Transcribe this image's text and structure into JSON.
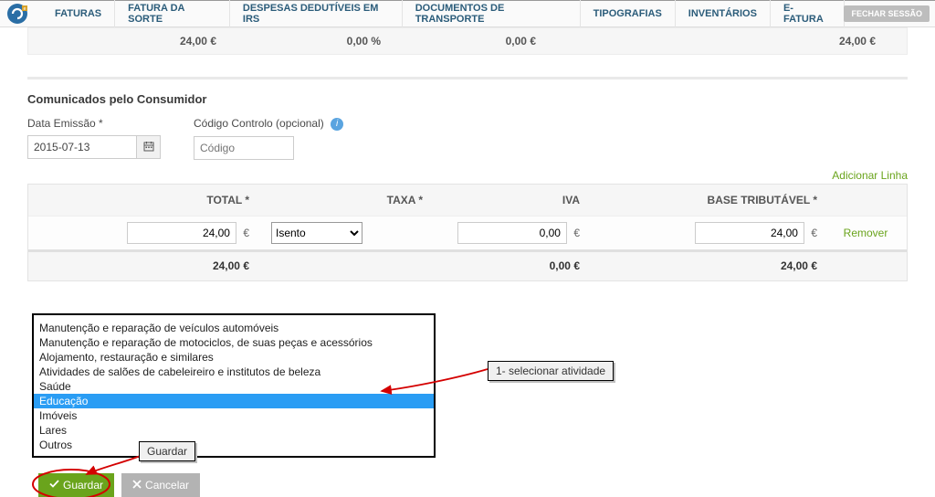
{
  "nav": {
    "items": [
      "FATURAS",
      "FATURA DA SORTE",
      "DESPESAS DEDUTÍVEIS EM IRS",
      "DOCUMENTOS DE TRANSPORTE",
      "TIPOGRAFIAS",
      "INVENTÁRIOS",
      "E-FATURA"
    ],
    "logout": "FECHAR SESSÃO"
  },
  "summary_top": {
    "c1": "24,00 €",
    "c2": "0,00 %",
    "c3": "0,00 €",
    "c4": "24,00 €"
  },
  "section": {
    "title": "Comunicados pelo Consumidor"
  },
  "form": {
    "date_label": "Data Emissão *",
    "date_value": "2015-07-13",
    "code_label": "Código Controlo (opcional)",
    "code_placeholder": "Código"
  },
  "add_line": "Adicionar Linha",
  "grid": {
    "headers": {
      "total": "TOTAL *",
      "taxa": "TAXA *",
      "iva": "IVA",
      "base": "BASE TRIBUTÁVEL *"
    },
    "row": {
      "total": "24,00",
      "taxa_selected": "Isento",
      "iva": "0,00",
      "base": "24,00",
      "currency": "€",
      "remove": "Remover"
    },
    "sum": {
      "total": "24,00 €",
      "iva": "0,00 €",
      "base": "24,00 €"
    }
  },
  "activities": [
    "Manutenção e reparação de veículos automóveis",
    "Manutenção e reparação de motociclos, de suas peças e acessórios",
    "Alojamento, restauração e similares",
    "Atividades de salões de cabeleireiro e institutos de beleza",
    "Saúde",
    "Educação",
    "Imóveis",
    "Lares",
    "Outros"
  ],
  "activity_selected_index": 5,
  "callouts": {
    "select_activity": "1- selecionar atividade",
    "save": "Guardar"
  },
  "buttons": {
    "save": "Guardar",
    "cancel": "Cancelar"
  }
}
